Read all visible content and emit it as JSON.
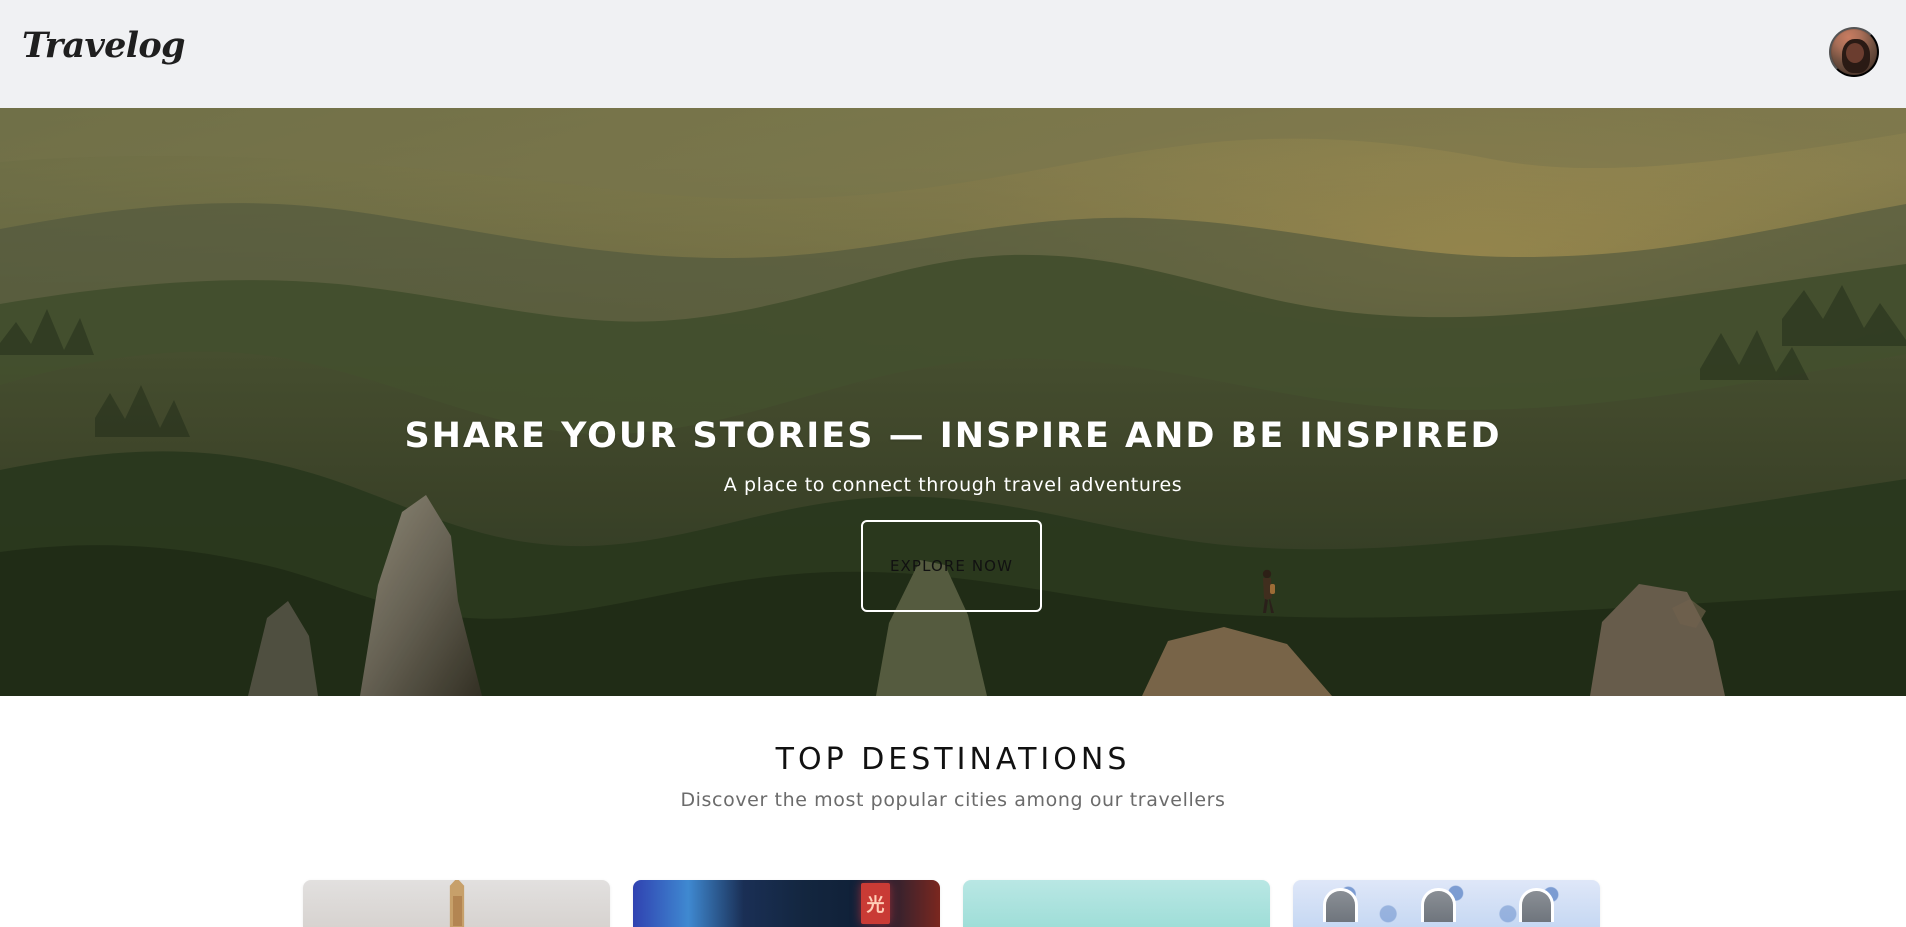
{
  "header": {
    "logo_text": "Travelog",
    "profile_icon": "avatar-icon"
  },
  "hero": {
    "title": "SHARE YOUR STORIES — INSPIRE AND BE INSPIRED",
    "subtitle": "A place to connect through travel adventures",
    "cta_label": "EXPLORE NOW"
  },
  "destinations": {
    "title": "TOP DESTINATIONS",
    "subtitle": "Discover the most popular cities among our travellers"
  },
  "colors": {
    "header_background": "#f0f1f3",
    "hero_text": "#ffffff",
    "section_title": "#111111",
    "section_subtitle": "#6b6b6b"
  }
}
